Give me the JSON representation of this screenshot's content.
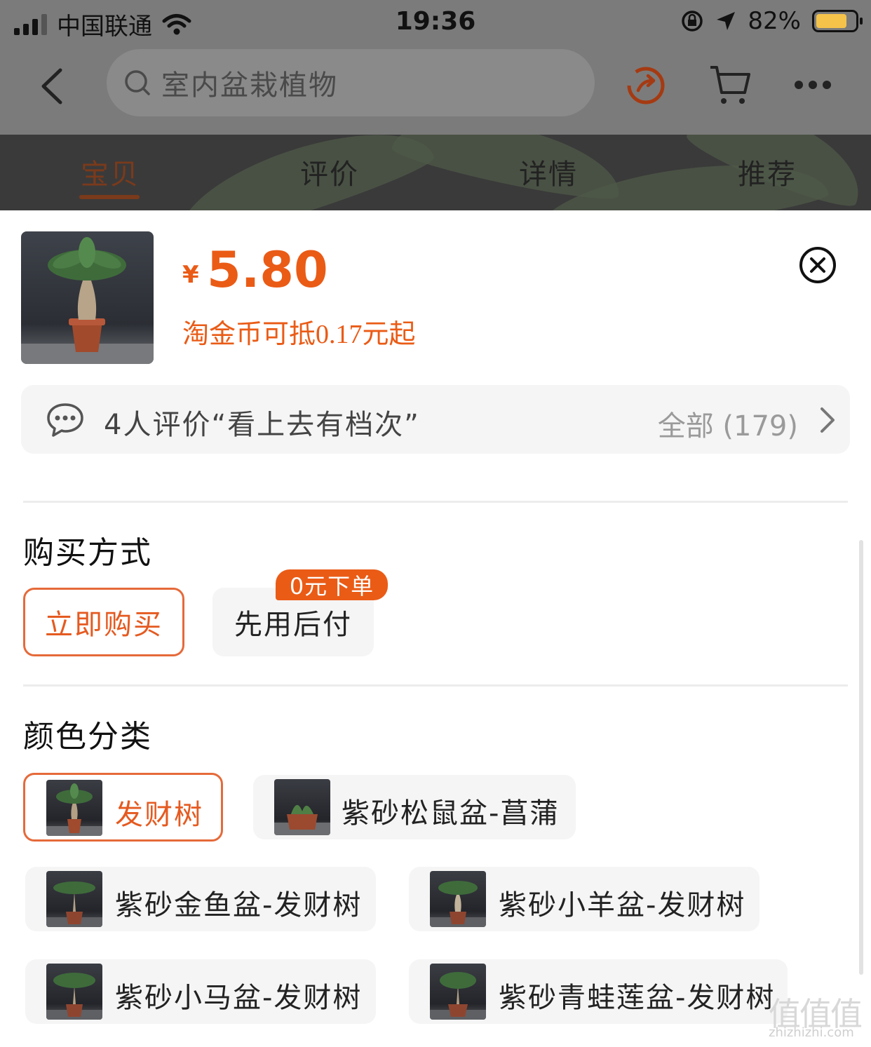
{
  "status_bar": {
    "carrier": "中国联通",
    "time": "19:36",
    "battery": "82%"
  },
  "nav": {
    "search_placeholder": "室内盆栽植物"
  },
  "tabs": [
    {
      "label": "宝贝",
      "active": true
    },
    {
      "label": "评价",
      "active": false
    },
    {
      "label": "详情",
      "active": false
    },
    {
      "label": "推荐",
      "active": false
    }
  ],
  "product": {
    "currency_symbol": "¥",
    "price": "5.80",
    "coin_note": "淘金币可抵0.17元起"
  },
  "review": {
    "summary": "4人评价“看上去有档次”",
    "all_label": "全部 (179)"
  },
  "purchase": {
    "title": "购买方式",
    "options": [
      "立即购买",
      "先用后付"
    ],
    "selected": "立即购买",
    "badge": "0元下单"
  },
  "color": {
    "title": "颜色分类",
    "options": [
      "发财树",
      "紫砂松鼠盆-菖蒲",
      "紫砂金鱼盆-发财树",
      "紫砂小羊盆-发财树",
      "紫砂小马盆-发财树",
      "紫砂青蛙莲盆-发财树"
    ],
    "selected": "发财树"
  },
  "colors": {
    "accent": "#ea5b16",
    "selected_border": "#e56a3a",
    "chip_bg": "#f5f5f5"
  },
  "watermark": {
    "logo": "值值值",
    "url": "zhizhizhi.com"
  }
}
